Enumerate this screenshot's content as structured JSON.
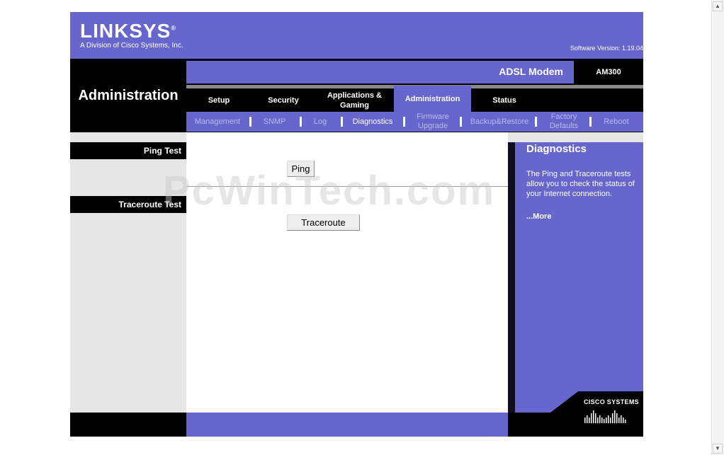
{
  "brand": {
    "logo": "LINKSYS",
    "registered": "®",
    "tagline": "A Division of Cisco Systems, Inc.",
    "software_version": "Software Version: 1.19.04"
  },
  "product": {
    "name": "ADSL Modem",
    "model": "AM300"
  },
  "section_title": "Administration",
  "tabs": [
    {
      "label": "Setup"
    },
    {
      "label": "Security"
    },
    {
      "label": "Applications & Gaming"
    },
    {
      "label": "Administration"
    },
    {
      "label": "Status"
    }
  ],
  "subnav": [
    {
      "label": "Management"
    },
    {
      "label": "SNMP"
    },
    {
      "label": "Log"
    },
    {
      "label": "Diagnostics"
    },
    {
      "label": "Firmware Upgrade"
    },
    {
      "label": "Backup&Restore"
    },
    {
      "label": "Factory Defaults"
    },
    {
      "label": "Reboot"
    }
  ],
  "sections": {
    "ping_test": "Ping Test",
    "traceroute_test": "Traceroute Test"
  },
  "buttons": {
    "ping": "Ping",
    "traceroute": "Traceroute"
  },
  "help": {
    "title": "Diagnostics",
    "text": "The Ping and Traceroute tests allow you to check the status of your Internet connection.",
    "more": "...More"
  },
  "footer": {
    "cisco_label": "CISCO SYSTEMS"
  },
  "watermark": "PcWinTech.com",
  "colors": {
    "accent": "#6666cc",
    "dark": "#000000",
    "panel": "#e6e6e6"
  },
  "icons": {
    "scroll_up": "triangle-up-icon",
    "scroll_down": "triangle-down-icon"
  }
}
